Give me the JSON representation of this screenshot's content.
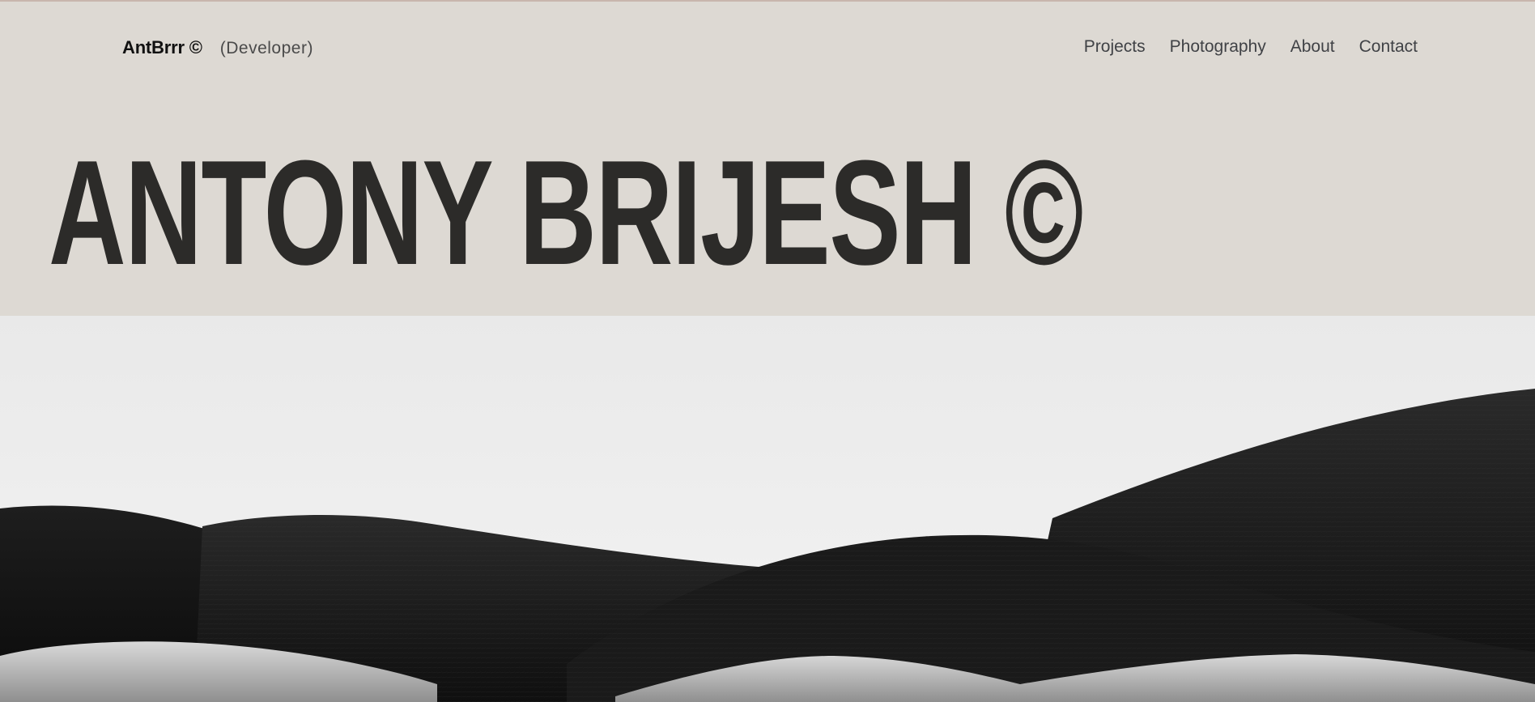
{
  "header": {
    "brand_name": "AntBrrr ©",
    "brand_role": "(Developer)"
  },
  "nav": {
    "items": [
      {
        "label": "Projects"
      },
      {
        "label": "Photography"
      },
      {
        "label": "About"
      },
      {
        "label": "Contact"
      }
    ]
  },
  "hero": {
    "title": "ANTONY BRIJESH ©"
  },
  "image": {
    "subject": "black and white rolling hills landscape"
  }
}
